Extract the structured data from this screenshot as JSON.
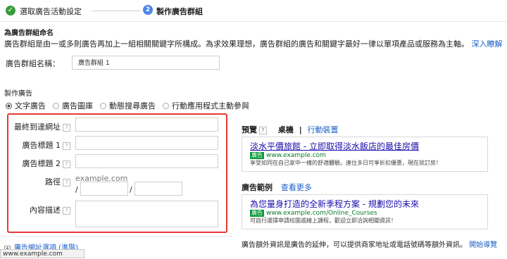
{
  "steps": {
    "step1_label": "選取廣告活動設定",
    "step2_number": "2",
    "step2_label": "製作廣告群組"
  },
  "section": {
    "title": "為廣告群組命名",
    "description": "廣告群組是由一或多則廣告再加上一組相關關鍵字所構成。為求效果理想，廣告群組的廣告和關鍵字最好一律以單項產品或服務為主軸。",
    "learn_more": "深入瞭解"
  },
  "group_name": {
    "label": "廣告群組名稱：",
    "value": "廣告群組 1"
  },
  "ad": {
    "title": "製作廣告",
    "types": [
      {
        "label": "文字廣告",
        "selected": true
      },
      {
        "label": "廣告圖庫",
        "selected": false
      },
      {
        "label": "動態搜尋廣告",
        "selected": false
      },
      {
        "label": "行動應用程式主動參與",
        "selected": false
      }
    ],
    "fields": {
      "final_url_label": "最終到達網址",
      "headline1_label": "廣告標題 1",
      "headline2_label": "廣告標題 2",
      "path_label": "路徑",
      "path_domain": "example.com",
      "path_sep": "/",
      "description_label": "內容描述"
    },
    "help_icon": "?"
  },
  "url_options": {
    "plus": "+",
    "label": "廣告網址選項 (進階)"
  },
  "status_bar": "www.example.com",
  "preview": {
    "label": "預覽",
    "desktop": "桌機",
    "divider": "|",
    "mobile": "行動裝置",
    "ad": {
      "title": "淡水平價旅館 - 立即取得淡水飯店的最佳房價",
      "badge": "廣告",
      "url": "www.example.com",
      "desc": "享受如同在自己家中一樣的舒適體驗。連住多日可享折扣優惠，現在就訂房！"
    }
  },
  "examples": {
    "label": "廣告範例",
    "see_more": "查看更多",
    "ad": {
      "title": "為您量身打造的全新季程方案 - 規劃您的未來",
      "badge": "廣告",
      "url": "www.example.com/Online_Courses",
      "desc": "可自行選擇申請校園或線上課程，歡迎立即洽詢相關資訊！"
    }
  },
  "extensions": {
    "text": "廣告額外資訊是廣告的延伸，可以提供商家地址或電話號碼等額外資訊。",
    "link": "開始導覽"
  },
  "colors": {
    "accent": "#4a86e8",
    "success": "#3a9a3a",
    "highlight": "#e53935",
    "link": "#1a5fc8",
    "ad_title": "#1a0dab",
    "ad_url": "#0a7a2a"
  }
}
